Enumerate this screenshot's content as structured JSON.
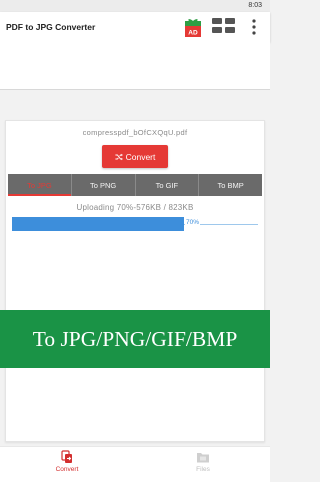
{
  "status_bar": {
    "time": "8:03"
  },
  "app_bar": {
    "title": "PDF to JPG Converter",
    "ad_badge": "AD",
    "icons": [
      "gift-ad-icon",
      "grid-apps-icon",
      "more-vert-icon"
    ]
  },
  "converter": {
    "file_name": "compresspdf_bOfCXQqU.pdf",
    "convert_label": "Convert",
    "tabs": [
      {
        "label": "To JPG",
        "active": true
      },
      {
        "label": "To PNG",
        "active": false
      },
      {
        "label": "To GIF",
        "active": false
      },
      {
        "label": "To BMP",
        "active": false
      }
    ],
    "upload_status": "Uploading 70%-576KB / 823KB",
    "progress_percent": 70,
    "progress_label": "70%"
  },
  "promo": {
    "text": "To JPG/PNG/GIF/BMP"
  },
  "bottom_nav": {
    "items": [
      {
        "label": "Convert",
        "icon": "convert-icon",
        "active": true
      },
      {
        "label": "Files",
        "icon": "files-icon",
        "active": false
      }
    ]
  },
  "colors": {
    "accent_red": "#e53935",
    "progress_blue": "#3d8edb",
    "promo_green": "#1a9346",
    "tab_gray": "#6a6a6a"
  }
}
